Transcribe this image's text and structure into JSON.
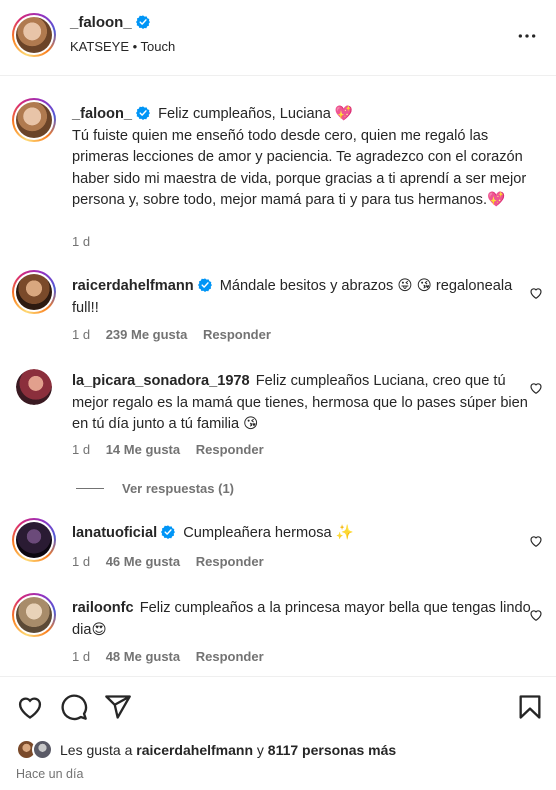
{
  "header": {
    "username": "_faloon_",
    "subtitle": "KATSEYE • Touch",
    "more_icon": "more-horizontal-icon"
  },
  "caption": {
    "username": "_faloon_",
    "text": "Feliz cumpleaños, Luciana 💖\nTú fuiste quien me enseñó todo desde cero, quien me regaló las primeras lecciones de amor y paciencia. Te agradezco con el corazón haber sido mi maestra de vida, porque gracias a ti aprendí a ser mejor persona y, sobre todo, mejor mamá para ti y para tus hermanos.💖",
    "time": "1 d"
  },
  "comments": [
    {
      "username": "raicerdahelfmann",
      "verified": true,
      "text": "Mándale besitos y abrazos 😜 😘 regaloneala full!!",
      "time": "1 d",
      "likes": "239 Me gusta",
      "reply": "Responder"
    },
    {
      "username": "la_picara_sonadora_1978",
      "verified": false,
      "text": "Feliz cumpleaños Luciana, creo que tú mejor regalo es la mamá que tienes, hermosa que lo pases súper bien en tú día junto a tú familia 😘",
      "time": "1 d",
      "likes": "14 Me gusta",
      "reply": "Responder"
    },
    {
      "username": "lanatuoficial",
      "verified": true,
      "text": "Cumpleañera hermosa ✨",
      "time": "1 d",
      "likes": "46 Me gusta",
      "reply": "Responder"
    },
    {
      "username": "railoonfc",
      "verified": false,
      "text": "Feliz cumpleaños a la princesa mayor bella que tengas lindo dia😍",
      "time": "1 d",
      "likes": "48 Me gusta",
      "reply": "Responder"
    }
  ],
  "view_replies": "Ver respuestas (1)",
  "actions": {
    "like_icon": "heart-icon",
    "comment_icon": "comment-icon",
    "share_icon": "send-icon",
    "save_icon": "bookmark-icon"
  },
  "likes": {
    "prefix": "Les gusta a",
    "user": "raicerdahelfmann",
    "connector": "y",
    "others": "8117 personas más"
  },
  "time_ago": "Hace un día",
  "colors": {
    "text": "#262626",
    "secondary": "#737373",
    "verified": "#0095f6",
    "divider": "#efefef"
  }
}
